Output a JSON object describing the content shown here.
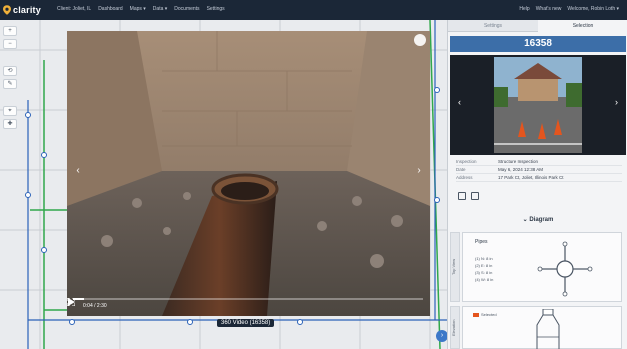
{
  "app": {
    "logo_text": "clarity",
    "nav": [
      "Client: Joliet, IL",
      "Dashboard",
      "Maps ▾",
      "Data ▾",
      "Documents",
      "Settings"
    ],
    "top_right": [
      "Help",
      "What's new",
      "Welcome, Robin Loth ▾"
    ]
  },
  "map": {
    "toolbar": [
      "+",
      "−",
      "⟲",
      "✎",
      "⌖",
      "✚"
    ]
  },
  "video": {
    "time": "0:04 / 2:30",
    "progress_fraction": 0.03,
    "caption": "360 Video (16358)"
  },
  "panel": {
    "tabs": [
      {
        "label": "Settings",
        "active": false
      },
      {
        "label": "Selection",
        "active": true
      }
    ],
    "asset_id": "16358",
    "info": [
      {
        "label": "Inspection",
        "value": "Structure Inspection"
      },
      {
        "label": "Date",
        "value": "May 6, 2024 12:38 AM"
      },
      {
        "label": "Address",
        "value": "17 Park Ct, Joliet, Illinois Park Ct"
      }
    ],
    "diagram_header": "Diagram",
    "pipes_title": "Pipes",
    "pipes": [
      "(1) N: 8 in",
      "(2) E: 8 in",
      "(3) S: 8 in",
      "(4) W: 8 in"
    ],
    "side_tab_top": "Top View",
    "side_tab_bottom": "Elevation",
    "elevation_label": "Selected"
  },
  "colors": {
    "topbar": "#1b2737",
    "accent": "#3c6ea8",
    "pipe_green": "#31a84b",
    "pipe_blue": "#2b62b8"
  }
}
